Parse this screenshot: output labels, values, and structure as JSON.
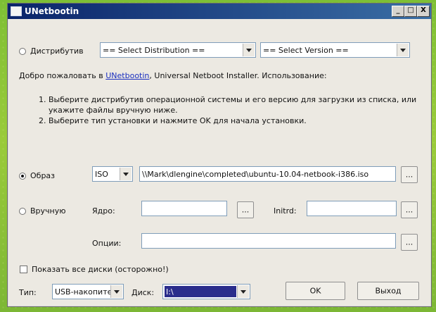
{
  "window": {
    "title": "UNetbootin",
    "min": "_",
    "max": "□",
    "close": "X"
  },
  "distribution": {
    "label": "Дистрибутив",
    "select_distribution": "== Select Distribution ==",
    "select_version": "== Select Version =="
  },
  "intro": {
    "before": "Добро пожаловать в ",
    "link": "UNetbootin",
    "after": ", Universal Netboot Installer. Использование:"
  },
  "steps": [
    {
      "num": "1.",
      "text": "Выберите дистрибутив операционной системы и его версию для загрузки из списка, или укажите файлы вручную ниже."
    },
    {
      "num": "2.",
      "text": "Выберите тип установки и нажмите OK для начала установки."
    }
  ],
  "image": {
    "label": "Образ",
    "type": "ISO",
    "path": "\\\\Mark\\dlengine\\completed\\ubuntu-10.04-netbook-i386.iso",
    "browse": "..."
  },
  "manual": {
    "label": "Вручную",
    "kernel_label": "Ядро:",
    "kernel_value": "",
    "initrd_label": "Initrd:",
    "initrd_value": "",
    "options_label": "Опции:",
    "options_value": "",
    "browse": "..."
  },
  "show_all": {
    "label": "Показать все диски (осторожно!)",
    "checked": false
  },
  "bottom": {
    "type_label": "Тип:",
    "type_value": "USB-накопите",
    "disk_label": "Диск:",
    "disk_value": "I:\\",
    "ok": "OK",
    "exit": "Выход"
  },
  "colors": {
    "title_start": "#0a246a",
    "title_end": "#3a6ea5",
    "disk_highlight": "#2a2d8c",
    "link": "#1a2fbf"
  }
}
